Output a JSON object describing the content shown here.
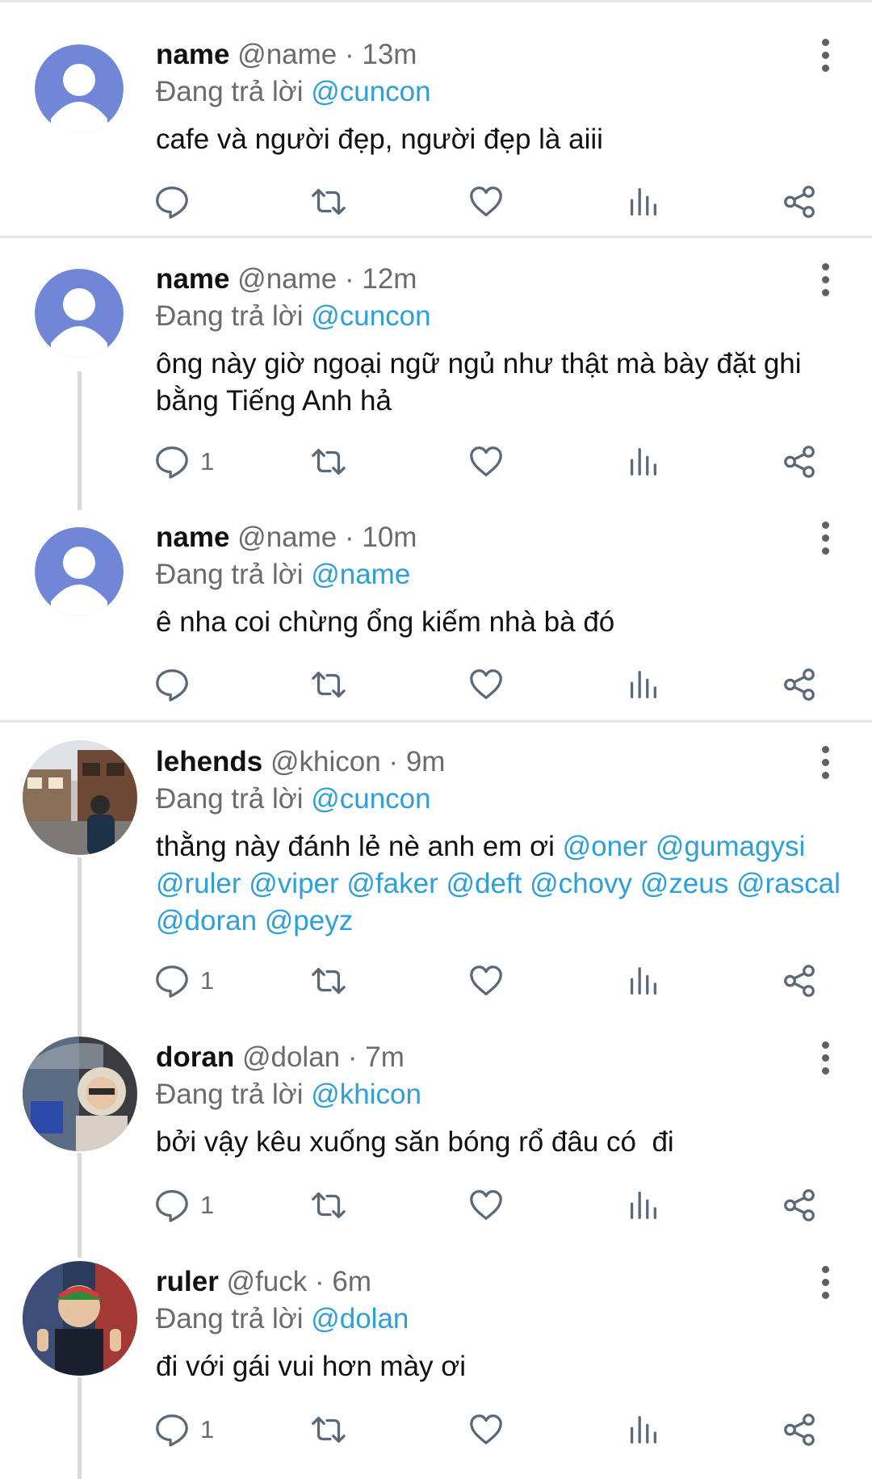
{
  "tweets": [
    {
      "name": "name",
      "handle": "@name",
      "dot": " · ",
      "time": "13m",
      "reply_prefix": "Đang trả lời ",
      "reply_to": "@cuncon",
      "text": "cafe và người đẹp, người đẹp là aiii",
      "reply_count": ""
    },
    {
      "name": "name",
      "handle": "@name",
      "dot": " · ",
      "time": "12m",
      "reply_prefix": "Đang trả lời ",
      "reply_to": "@cuncon",
      "text": "ông này giờ ngoại ngữ ngủ như thật mà bày đặt ghi bằng Tiếng Anh hả",
      "reply_count": "1"
    },
    {
      "name": "name",
      "handle": "@name",
      "dot": " · ",
      "time": "10m",
      "reply_prefix": "Đang trả lời ",
      "reply_to": "@name",
      "text": "ê nha coi chừng ổng kiếm nhà bà đó",
      "reply_count": ""
    },
    {
      "name": "lehends",
      "handle": "@khicon",
      "dot": " · ",
      "time": "9m",
      "reply_prefix": "Đang trả lời ",
      "reply_to": "@cuncon",
      "text": "thằng này đánh lẻ nè anh em ơi ",
      "mentions": "@oner @gumagysi @ruler @viper @faker @deft @chovy @zeus @rascal @doran @peyz",
      "reply_count": "1"
    },
    {
      "name": "doran",
      "handle": "@dolan",
      "dot": " · ",
      "time": "7m",
      "reply_prefix": "Đang trả lời ",
      "reply_to": "@khicon",
      "text": "bởi vậy kêu xuống săn bóng rổ đâu có  đi",
      "reply_count": "1"
    },
    {
      "name": "ruler",
      "handle": "@fuck",
      "dot": " · ",
      "time": "6m",
      "reply_prefix": "Đang trả lời ",
      "reply_to": "@dolan",
      "text": "đi với gái vui hơn mày ơi",
      "reply_count": "1"
    }
  ],
  "colors": {
    "mention": "#2d9fd9",
    "muted": "#6b6b6b",
    "icon": "#5b6877",
    "avatar_default": "#6f87d6"
  },
  "icons": [
    "reply-icon",
    "retweet-icon",
    "like-icon",
    "views-icon",
    "share-icon",
    "more-options-icon"
  ]
}
